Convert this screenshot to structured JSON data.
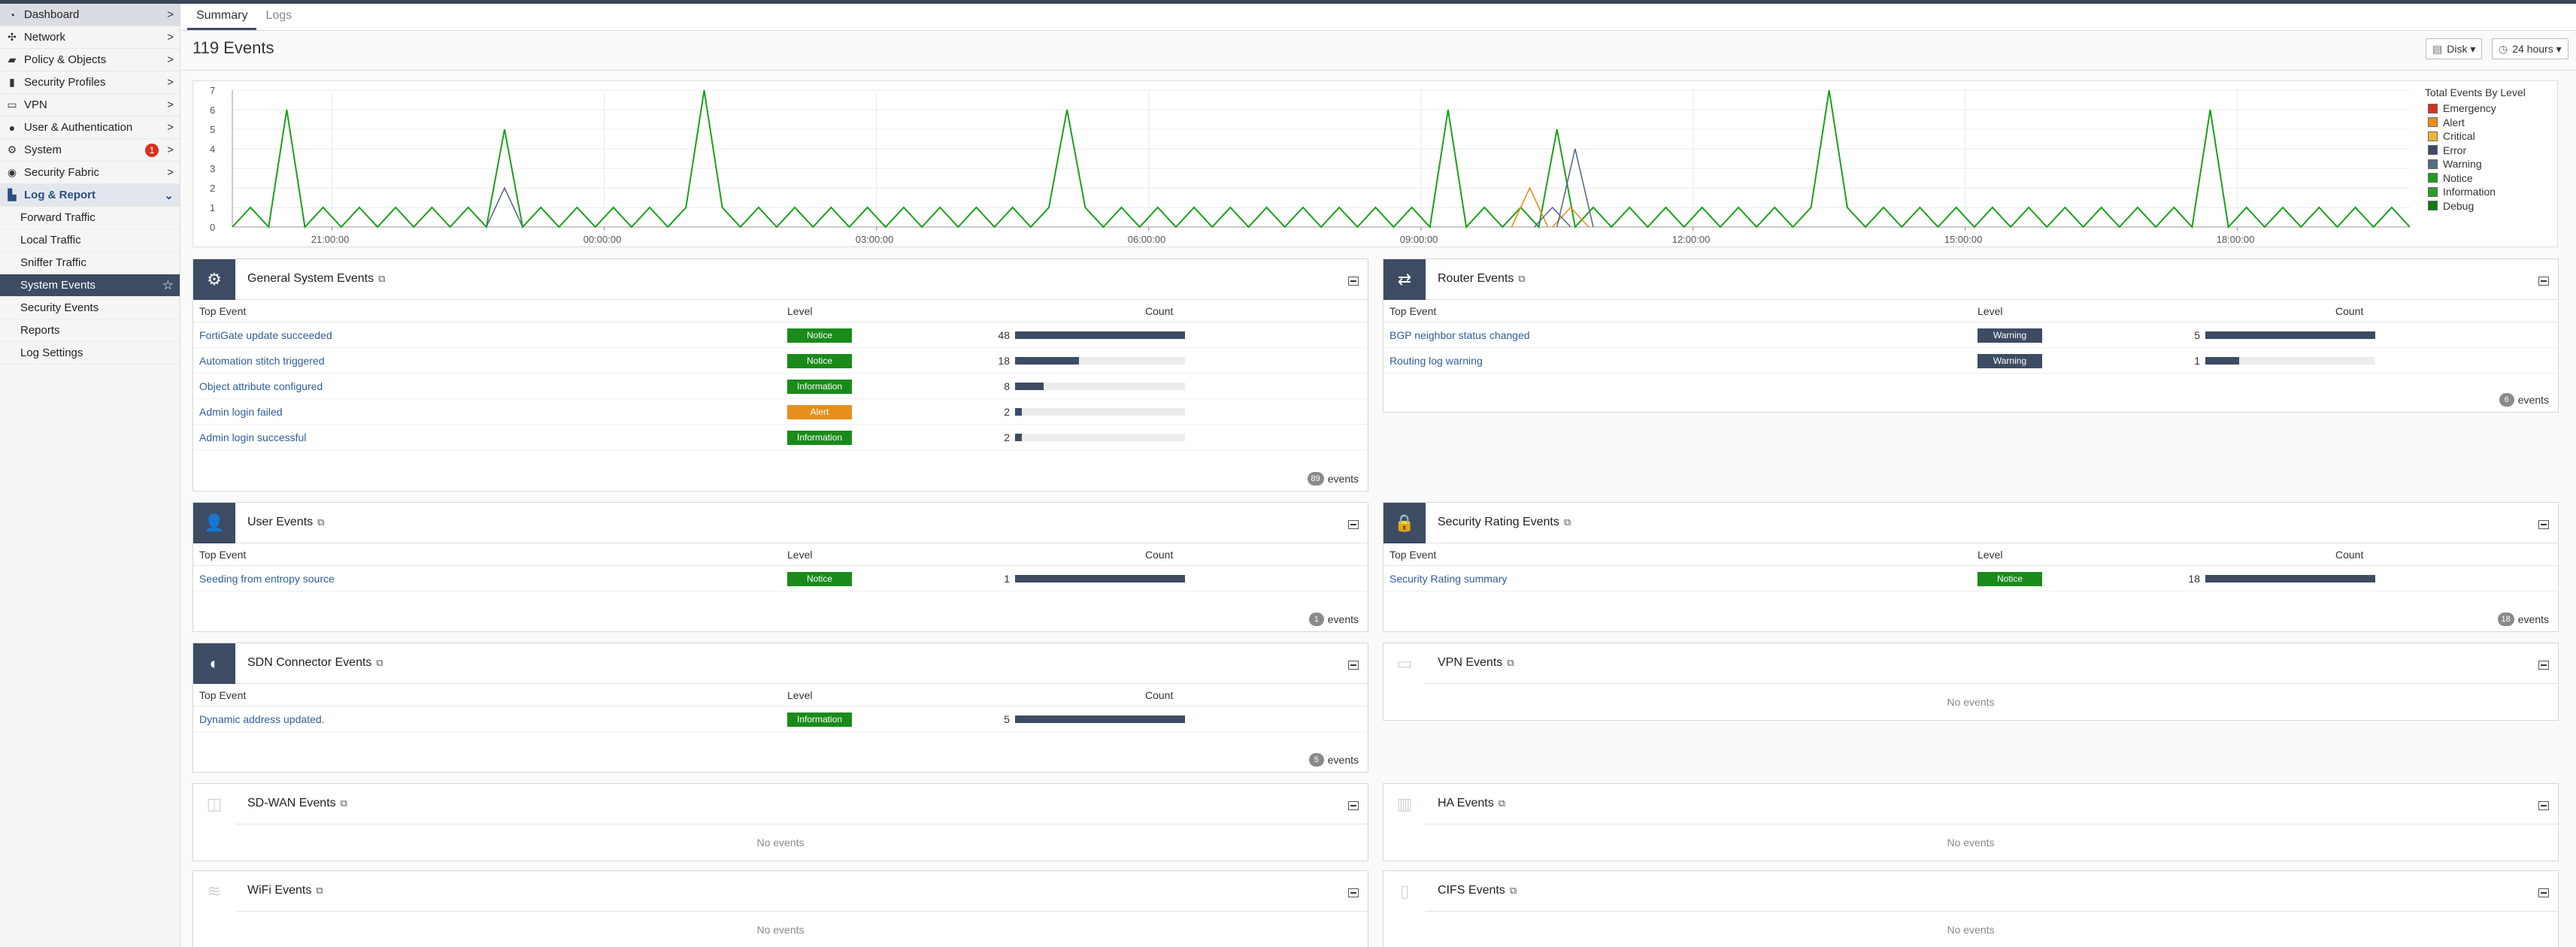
{
  "sidebar": {
    "items": [
      {
        "label": "Dashboard",
        "icon": "gauge-icon",
        "glyph": "◔",
        "chevron": ">"
      },
      {
        "label": "Network",
        "icon": "network-icon",
        "glyph": "✣",
        "chevron": ">"
      },
      {
        "label": "Policy & Objects",
        "icon": "policy-icon",
        "glyph": "▰",
        "chevron": ">"
      },
      {
        "label": "Security Profiles",
        "icon": "lock-icon",
        "glyph": "▮",
        "chevron": ">"
      },
      {
        "label": "VPN",
        "icon": "laptop-icon",
        "glyph": "▭",
        "chevron": ">"
      },
      {
        "label": "User & Authentication",
        "icon": "user-icon",
        "glyph": "●",
        "chevron": ">"
      },
      {
        "label": "System",
        "icon": "gear-icon",
        "glyph": "⚙",
        "chevron": ">",
        "badge": "1"
      },
      {
        "label": "Security Fabric",
        "icon": "fabric-icon",
        "glyph": "◉",
        "chevron": ">"
      }
    ],
    "log_report": {
      "label": "Log & Report",
      "icon": "chart-icon",
      "glyph": "▙",
      "chevron": "⌄"
    },
    "sub_items": [
      "Forward Traffic",
      "Local Traffic",
      "Sniffer Traffic",
      "System Events",
      "Security Events"
    ],
    "active_sub": "System Events",
    "star": "☆",
    "plain_items": [
      "Reports",
      "Log Settings"
    ]
  },
  "tabs": {
    "summary": "Summary",
    "logs": "Logs"
  },
  "header": {
    "title": "119 Events",
    "disk_btn": "Disk ▾",
    "time_btn": "24 hours ▾",
    "disk_icon": "▤",
    "time_icon": "◷"
  },
  "chart_data": {
    "type": "line",
    "title": "",
    "legend_title": "Total Events By Level",
    "legend": [
      {
        "name": "Emergency",
        "color": "#d9311d"
      },
      {
        "name": "Alert",
        "color": "#e88e1c"
      },
      {
        "name": "Critical",
        "color": "#f2b636"
      },
      {
        "name": "Error",
        "color": "#3d4b63"
      },
      {
        "name": "Warning",
        "color": "#5a6b87"
      },
      {
        "name": "Notice",
        "color": "#1aa01a"
      },
      {
        "name": "Information",
        "color": "#2a9d2a"
      },
      {
        "name": "Debug",
        "color": "#0f7d0f"
      }
    ],
    "ylim": [
      0,
      7
    ],
    "yticks": [
      "0",
      "1",
      "2",
      "3",
      "4",
      "5",
      "6",
      "7"
    ],
    "xticks": [
      "21:00:00",
      "00:00:00",
      "03:00:00",
      "06:00:00",
      "09:00:00",
      "12:00:00",
      "15:00:00",
      "18:00:00"
    ],
    "green_spikes": [
      {
        "x": 0.7,
        "v": 6
      },
      {
        "x": 3.0,
        "v": 5
      },
      {
        "x": 5.2,
        "v": 7
      },
      {
        "x": 9.2,
        "v": 6
      },
      {
        "x": 13.4,
        "v": 6
      },
      {
        "x": 14.6,
        "v": 5
      },
      {
        "x": 17.6,
        "v": 7
      },
      {
        "x": 21.8,
        "v": 6
      }
    ],
    "other_series": [
      {
        "name": "Alert",
        "points": [
          {
            "x": 14.3,
            "v": 2
          },
          {
            "x": 14.75,
            "v": 1
          }
        ]
      },
      {
        "name": "Warning",
        "points": [
          {
            "x": 3.0,
            "v": 2
          },
          {
            "x": 14.8,
            "v": 4
          },
          {
            "x": 14.55,
            "v": 1
          }
        ]
      }
    ]
  },
  "widgets": {
    "general": {
      "title": "General System Events",
      "icon_glyph": "⚙",
      "cols": [
        "Top Event",
        "Level",
        "Count"
      ],
      "rows": [
        {
          "event": "FortiGate update succeeded",
          "level": "Notice",
          "color": "#1a8a1a",
          "count": "48",
          "frac": 1.0
        },
        {
          "event": "Automation stitch triggered",
          "level": "Notice",
          "color": "#1a8a1a",
          "count": "18",
          "frac": 0.375
        },
        {
          "event": "Object attribute configured",
          "level": "Information",
          "color": "#1a8a1a",
          "count": "8",
          "frac": 0.167
        },
        {
          "event": "Admin login failed",
          "level": "Alert",
          "color": "#e88e1c",
          "count": "2",
          "frac": 0.042
        },
        {
          "event": "Admin login successful",
          "level": "Information",
          "color": "#1a8a1a",
          "count": "2",
          "frac": 0.042
        }
      ],
      "total": "89",
      "total_suffix": "events"
    },
    "router": {
      "title": "Router Events",
      "icon_glyph": "⇄",
      "cols": [
        "Top Event",
        "Level",
        "Count"
      ],
      "rows": [
        {
          "event": "BGP neighbor status changed",
          "level": "Warning",
          "color": "#3d4b63",
          "count": "5",
          "frac": 1.0
        },
        {
          "event": "Routing log warning",
          "level": "Warning",
          "color": "#3d4b63",
          "count": "1",
          "frac": 0.2
        }
      ],
      "total": "6",
      "total_suffix": "events"
    },
    "user": {
      "title": "User Events",
      "icon_glyph": "👤",
      "cols": [
        "Top Event",
        "Level",
        "Count"
      ],
      "rows": [
        {
          "event": "Seeding from entropy source",
          "level": "Notice",
          "color": "#1a8a1a",
          "count": "1",
          "frac": 1.0
        }
      ],
      "total": "1",
      "total_suffix": "events"
    },
    "security_rating": {
      "title": "Security Rating Events",
      "icon_glyph": "🔒",
      "cols": [
        "Top Event",
        "Level",
        "Count"
      ],
      "rows": [
        {
          "event": "Security Rating summary",
          "level": "Notice",
          "color": "#1a8a1a",
          "count": "18",
          "frac": 1.0
        }
      ],
      "total": "18",
      "total_suffix": "events"
    },
    "sdn": {
      "title": "SDN Connector Events",
      "icon_glyph": "◐",
      "cols": [
        "Top Event",
        "Level",
        "Count"
      ],
      "rows": [
        {
          "event": "Dynamic address updated.",
          "level": "Information",
          "color": "#1a8a1a",
          "count": "5",
          "frac": 1.0
        }
      ],
      "total": "5",
      "total_suffix": "events"
    },
    "vpn": {
      "title": "VPN Events",
      "icon_glyph": "▭",
      "empty": "No events"
    },
    "sdwan": {
      "title": "SD-WAN Events",
      "icon_glyph": "◫",
      "empty": "No events"
    },
    "ha": {
      "title": "HA Events",
      "icon_glyph": "▥",
      "empty": "No events"
    },
    "wifi": {
      "title": "WiFi Events",
      "icon_glyph": "≋",
      "empty": "No events"
    },
    "cifs": {
      "title": "CIFS Events",
      "icon_glyph": "▯",
      "empty": "No events"
    }
  },
  "ext_glyph": "⧉"
}
